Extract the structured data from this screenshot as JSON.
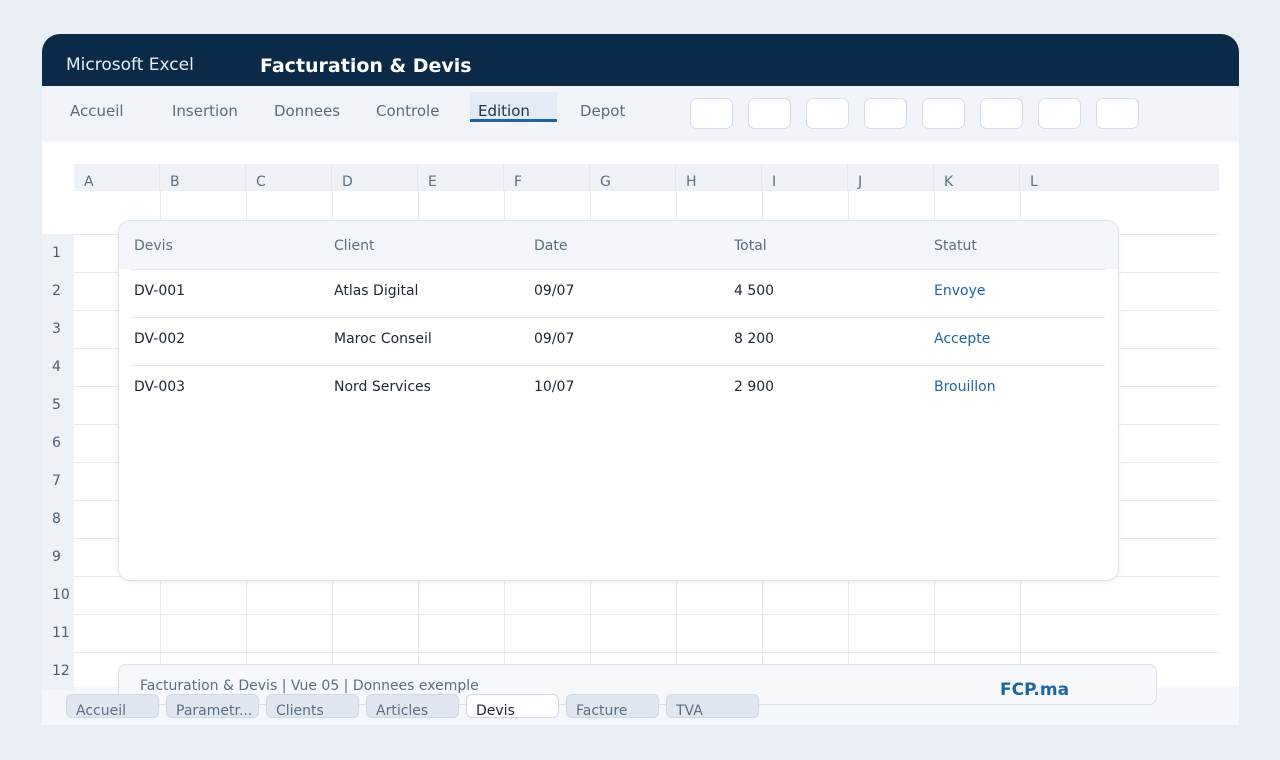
{
  "app": {
    "name": "Microsoft Excel",
    "document_title": "Facturation & Devis"
  },
  "ribbon": {
    "tabs": [
      {
        "label": "Accueil",
        "active": false
      },
      {
        "label": "Insertion",
        "active": false
      },
      {
        "label": "Donnees",
        "active": false
      },
      {
        "label": "Controle",
        "active": false
      },
      {
        "label": "Edition",
        "active": true
      },
      {
        "label": "Depot",
        "active": false
      }
    ],
    "tool_buttons_count": 8
  },
  "sheet": {
    "columns": [
      "A",
      "B",
      "C",
      "D",
      "E",
      "F",
      "G",
      "H",
      "I",
      "J",
      "K",
      "L"
    ],
    "rows": [
      "1",
      "2",
      "3",
      "4",
      "5",
      "6",
      "7",
      "8",
      "9",
      "10",
      "11",
      "12"
    ]
  },
  "table": {
    "headers": [
      "Devis",
      "Client",
      "Date",
      "Total",
      "Statut"
    ],
    "rows": [
      {
        "devis": "DV-001",
        "client": "Atlas Digital",
        "date": "09/07",
        "total": "4 500",
        "statut": "Envoye"
      },
      {
        "devis": "DV-002",
        "client": "Maroc Conseil",
        "date": "09/07",
        "total": "8 200",
        "statut": "Accepte"
      },
      {
        "devis": "DV-003",
        "client": "Nord Services",
        "date": "10/07",
        "total": "2 900",
        "statut": "Brouillon"
      }
    ]
  },
  "footer": {
    "text": "Facturation & Devis | Vue 05 | Donnees exemple",
    "brand": "FCP.ma"
  },
  "sheet_tabs": [
    {
      "label": "Accueil",
      "active": false
    },
    {
      "label": "Parametr...",
      "active": false
    },
    {
      "label": "Clients",
      "active": false
    },
    {
      "label": "Articles",
      "active": false
    },
    {
      "label": "Devis",
      "active": true
    },
    {
      "label": "Facture",
      "active": false
    },
    {
      "label": "TVA",
      "active": false
    }
  ],
  "colors": {
    "titlebar": "#0b2a47",
    "accent": "#1c64a6",
    "background": "#e9edf4"
  }
}
